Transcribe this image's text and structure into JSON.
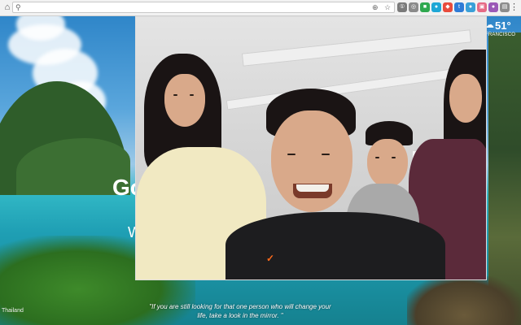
{
  "browser": {
    "home_icon": "home-icon",
    "search_icon": "search-icon",
    "address_value": "",
    "address_placeholder": "",
    "extensions": [
      {
        "name": "ext-1",
        "color": "#7a7a7a",
        "glyph": "①"
      },
      {
        "name": "ext-2",
        "color": "#8a8a8a",
        "glyph": "◎"
      },
      {
        "name": "ext-3",
        "color": "#2fa84f",
        "glyph": "■"
      },
      {
        "name": "ext-4",
        "color": "#1ea7d6",
        "glyph": "●"
      },
      {
        "name": "ext-5",
        "color": "#e84b3c",
        "glyph": "◆"
      },
      {
        "name": "ext-6",
        "color": "#2f7bd6",
        "glyph": "t"
      },
      {
        "name": "ext-7",
        "color": "#3aa0d8",
        "glyph": "●"
      },
      {
        "name": "ext-8",
        "color": "#e66b85",
        "glyph": "▣"
      },
      {
        "name": "ext-9",
        "color": "#9b59b6",
        "glyph": "●"
      },
      {
        "name": "ext-10",
        "color": "#8c8c8c",
        "glyph": "▤"
      }
    ]
  },
  "background": {
    "greeting_partial": "Go",
    "greeting_sub_partial": "W",
    "location": "Thailand",
    "quote": "\"If you are still looking for that one person who will change your life, take a look in the mirror. \""
  },
  "weather": {
    "icon": "partly-cloudy-icon",
    "temperature": "51°",
    "location_partial": "FRANCISCO"
  },
  "colors": {
    "toolbar_bg": "#f2f2f2",
    "sky": "#2f86c9",
    "sea": "#1f9fb4",
    "webcam_frame": "#dddddd"
  }
}
